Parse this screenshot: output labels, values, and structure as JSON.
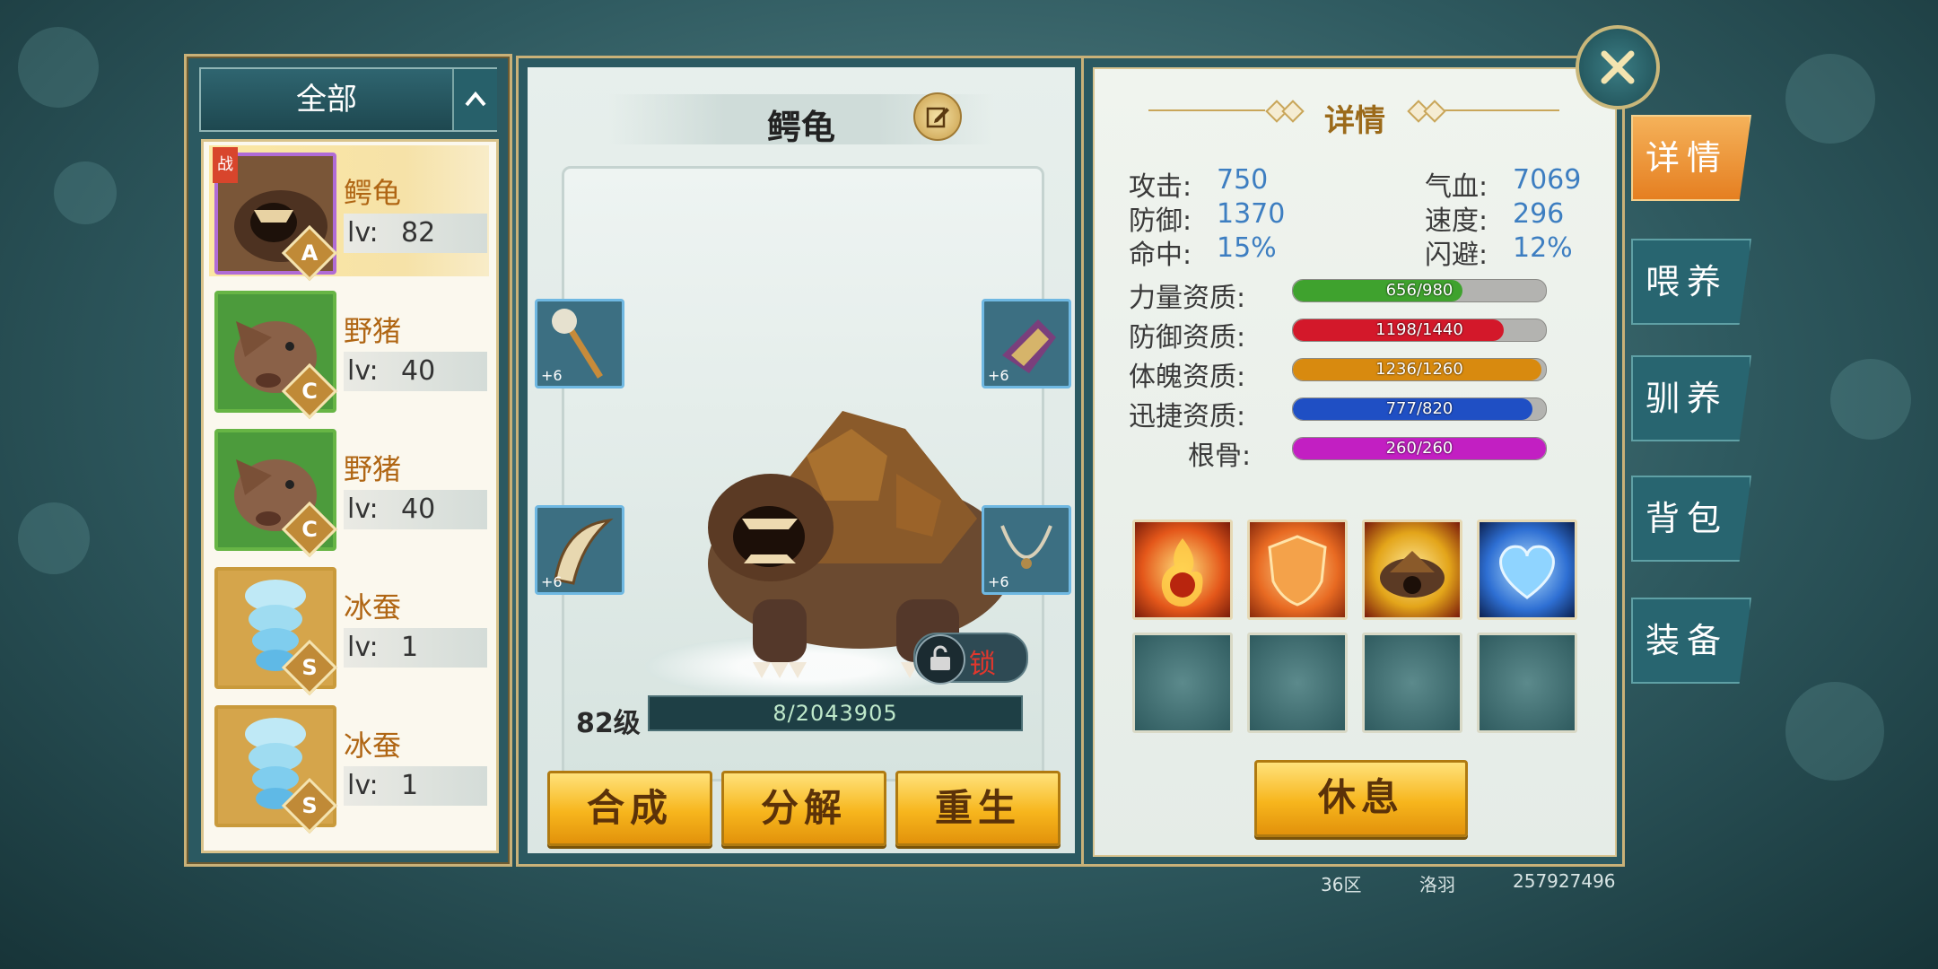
{
  "filter": {
    "label": "全部"
  },
  "pets": [
    {
      "name": "鳄龟",
      "lv_label": "lv:",
      "lv": "82",
      "rank": "A",
      "tag": "战"
    },
    {
      "name": "野猪",
      "lv_label": "lv:",
      "lv": "40",
      "rank": "C"
    },
    {
      "name": "野猪",
      "lv_label": "lv:",
      "lv": "40",
      "rank": "C"
    },
    {
      "name": "冰蚕",
      "lv_label": "lv:",
      "lv": "1",
      "rank": "S"
    },
    {
      "name": "冰蚕",
      "lv_label": "lv:",
      "lv": "1",
      "rank": "S"
    }
  ],
  "selected_pet": {
    "name": "鳄龟",
    "level_label": "82级",
    "exp_text": "8/2043905",
    "lock_label": "锁",
    "equip_plus": [
      "+6",
      "+6",
      "+6",
      "+6"
    ]
  },
  "actions": {
    "combine": "合成",
    "decompose": "分解",
    "rebirth": "重生",
    "rest": "休息"
  },
  "detail": {
    "title": "详情",
    "stats": [
      {
        "label": "攻击:",
        "value": "750"
      },
      {
        "label": "气血:",
        "value": "7069"
      },
      {
        "label": "防御:",
        "value": "1370"
      },
      {
        "label": "速度:",
        "value": "296"
      },
      {
        "label": "命中:",
        "value": "15%"
      },
      {
        "label": "闪避:",
        "value": "12%"
      }
    ],
    "aptitudes": [
      {
        "label": "力量资质:",
        "text": "656/980",
        "current": 656,
        "max": 980,
        "color": "#3fa22e"
      },
      {
        "label": "防御资质:",
        "text": "1198/1440",
        "current": 1198,
        "max": 1440,
        "color": "#d3182a"
      },
      {
        "label": "体魄资质:",
        "text": "1236/1260",
        "current": 1236,
        "max": 1260,
        "color": "#d88a0f"
      },
      {
        "label": "迅捷资质:",
        "text": "777/820",
        "current": 777,
        "max": 820,
        "color": "#1f4fc4"
      },
      {
        "label": "根骨:",
        "text": "260/260",
        "current": 260,
        "max": 260,
        "color": "#c21fc2"
      }
    ]
  },
  "side_tabs": [
    "详情",
    "喂养",
    "驯养",
    "背包",
    "装备"
  ],
  "footer": {
    "server": "36区",
    "player": "洛羽",
    "id": "257927496"
  }
}
